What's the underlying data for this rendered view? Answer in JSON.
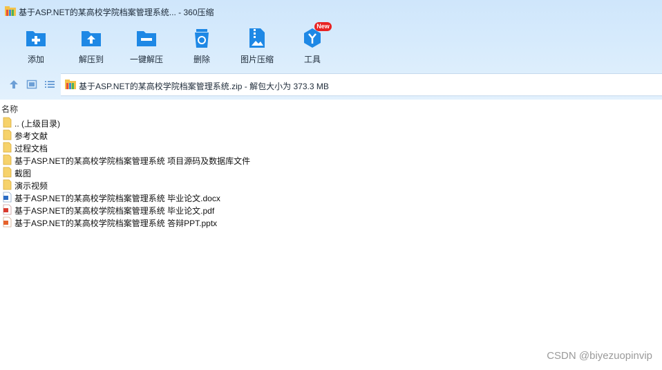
{
  "window": {
    "title": "基于ASP.NET的某高校学院档案管理系统... - 360压缩",
    "app_icon": "archive-icon"
  },
  "toolbar": {
    "buttons": [
      {
        "label": "添加",
        "icon": "add-folder-icon"
      },
      {
        "label": "解压到",
        "icon": "extract-to-icon"
      },
      {
        "label": "一键解压",
        "icon": "one-click-extract-icon"
      },
      {
        "label": "删除",
        "icon": "recycle-bin-icon"
      },
      {
        "label": "图片压缩",
        "icon": "image-compress-icon"
      },
      {
        "label": "工具",
        "icon": "tools-icon"
      }
    ],
    "badge": "New"
  },
  "address": {
    "text": "基于ASP.NET的某高校学院档案管理系统.zip - 解包大小为 373.3 MB"
  },
  "list": {
    "column_name": "名称",
    "items": [
      {
        "name": ".. (上级目录)",
        "type": "folder"
      },
      {
        "name": "参考文献",
        "type": "folder"
      },
      {
        "name": "过程文档",
        "type": "folder"
      },
      {
        "name": "基于ASP.NET的某高校学院档案管理系统 项目源码及数据库文件",
        "type": "folder"
      },
      {
        "name": "截图",
        "type": "folder"
      },
      {
        "name": "演示视频",
        "type": "folder"
      },
      {
        "name": "基于ASP.NET的某高校学院档案管理系统 毕业论文.docx",
        "type": "docx"
      },
      {
        "name": "基于ASP.NET的某高校学院档案管理系统 毕业论文.pdf",
        "type": "pdf"
      },
      {
        "name": "基于ASP.NET的某高校学院档案管理系统 答辩PPT.pptx",
        "type": "pptx"
      }
    ]
  },
  "watermark": "CSDN @biyezuopinvip",
  "colors": {
    "accent_blue": "#1e88e5",
    "folder_yellow": "#f6d26b",
    "badge_red": "#e82222"
  }
}
